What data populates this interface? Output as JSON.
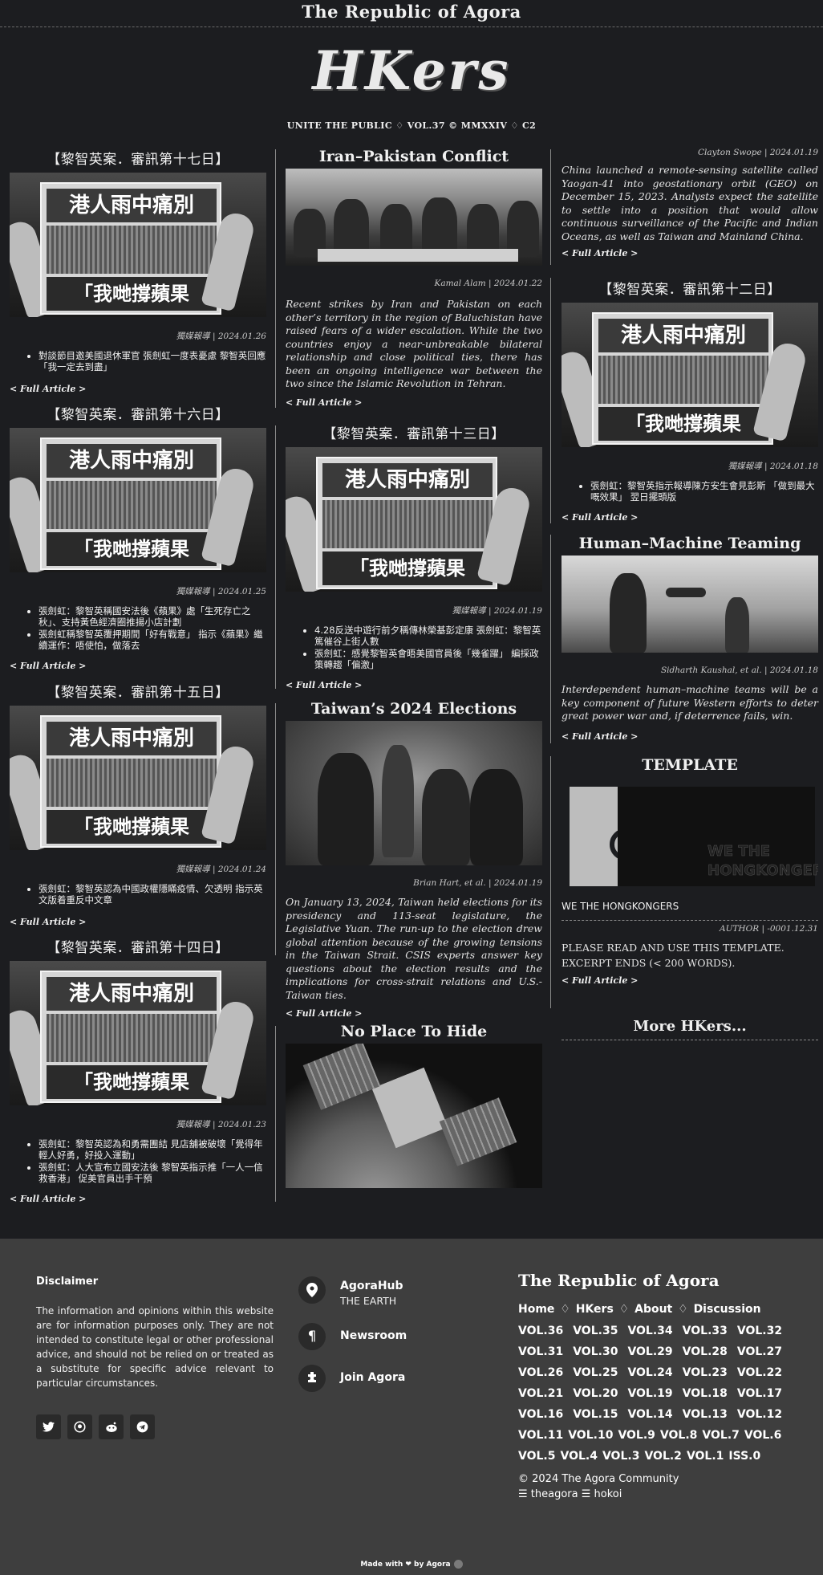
{
  "site": {
    "top_title": "The Republic of Agora",
    "logo": "HKers",
    "tagline": "UNITE THE PUBLIC ♢ VOL.37 © MMXXIV ♢ C2"
  },
  "labels": {
    "full_article": "< Full Article >",
    "more": "More HKers..."
  },
  "col1": [
    {
      "title": "【黎智英案．審訊第十七日】",
      "paper_top": "港人雨中痛別",
      "paper_bottom": "「我哋撐蘋果",
      "meta": "獨媒報導 | 2024.01.26",
      "bullets": [
        "對談節目邀美國退休軍官 張劍虹一度表憂慮 黎智英回應「我一定去到盡」"
      ]
    },
    {
      "title": "【黎智英案．審訊第十六日】",
      "paper_top": "港人雨中痛別",
      "paper_bottom": "「我哋撐蘋果",
      "meta": "獨媒報導 | 2024.01.25",
      "bullets": [
        "張劍虹：黎智英稱國安法後《蘋果》處「生死存亡之秋」、支持黃色經濟圈推揚小店計劃",
        "張劍虹稱黎智英覆押期間「好有戰意」 指示《蘋果》繼續運作：唔使怕，做落去"
      ]
    },
    {
      "title": "【黎智英案．審訊第十五日】",
      "paper_top": "港人雨中痛別",
      "paper_bottom": "「我哋撐蘋果",
      "meta": "獨媒報導 | 2024.01.24",
      "bullets": [
        "張劍虹：黎智英認為中國政權隱瞞疫情、欠透明 指示英文版着重反中文章"
      ]
    },
    {
      "title": "【黎智英案．審訊第十四日】",
      "paper_top": "港人雨中痛別",
      "paper_bottom": "「我哋撐蘋果",
      "meta": "獨媒報導 | 2024.01.23",
      "bullets": [
        "張劍虹：黎智英認為和勇需團結 見店舖被破壞「覺得年輕人好勇，好投入運動」",
        "張劍虹：人大宣布立國安法後 黎智英指示推「一人一信救香港」 促美官員出手干預"
      ]
    }
  ],
  "col2": [
    {
      "title": "Iran–Pakistan Conflict",
      "meta": "Kamal Alam | 2024.01.22",
      "summary": "Recent strikes by Iran and Pakistan on each other’s territory in the region of Baluchistan have raised fears of a wider escalation. While the two countries enjoy a near-unbreakable bilateral relationship and close political ties, there has been an ongoing intelligence war between the two since the Islamic Revolution in Tehran."
    },
    {
      "title": "【黎智英案．審訊第十三日】",
      "paper_top": "港人雨中痛別",
      "paper_bottom": "「我哋撐蘋果",
      "meta": "獨媒報導 | 2024.01.19",
      "bullets": [
        "4.28反送中遊行前夕稱傳林榮基彭定康 張劍虹：黎智英篤催谷上街人數",
        "張劍虹：感覺黎智英會晤美國官員後「幾雀躍」 編採政策轉趨「偏激」"
      ]
    },
    {
      "title": "Taiwan’s 2024 Elections",
      "meta": "Brian Hart, et al. | 2024.01.19",
      "summary": "On January 13, 2024, Taiwan held elections for its presidency and 113-seat legislature, the Legislative Yuan. The run-up to the election drew global attention because of the growing tensions in the Taiwan Strait. CSIS experts answer key questions about the election results and the implications for cross-strait relations and U.S.-Taiwan ties."
    },
    {
      "title": "No Place To Hide"
    }
  ],
  "col3": [
    {
      "meta": "Clayton Swope | 2024.01.19",
      "summary": "China launched a remote-sensing satellite called Yaogan-41 into geostationary orbit (GEO) on December 15, 2023. Analysts expect the satellite to settle into a position that would allow continuous surveillance of the Pacific and Indian Oceans, as well as Taiwan and Mainland China."
    },
    {
      "title": "【黎智英案．審訊第十二日】",
      "paper_top": "港人雨中痛別",
      "paper_bottom": "「我哋撐蘋果",
      "meta": "獨媒報導 | 2024.01.18",
      "bullets": [
        "張劍虹：黎智英指示報導陳方安生會見彭斯 「做到最大嘅效果」 翌日擺頭版"
      ]
    },
    {
      "title": "Human–Machine Teaming",
      "meta": "Sidharth Kaushal, et al. | 2024.01.18",
      "summary": "Interdependent human–machine teams will be a key component of future Western efforts to deter great power war and, if deterrence fails, win."
    },
    {
      "title": "TEMPLATE",
      "logo_text1": "WE THE",
      "logo_text2": "HONGKONGERS",
      "caption": "WE THE HONGKONGERS",
      "meta": "AUTHOR | -0001.12.31",
      "body": "PLEASE READ AND USE THIS TEMPLATE. EXCERPT ENDS (< 200 WORDS)."
    }
  ],
  "footer": {
    "disclaimer_title": "Disclaimer",
    "disclaimer": "The information and opinions within this website are for information purposes only. They are not intended to constitute legal or other professional advice, and should not be relied on or treated as a substitute for specific advice relevant to particular circumstances.",
    "hub_title": "AgoraHub",
    "hub_sub": "THE EARTH",
    "newsroom": "Newsroom",
    "join": "Join Agora",
    "brand": "The Republic of Agora",
    "nav": [
      "Home",
      "HKers",
      "About",
      "Discussion"
    ],
    "nav_sep": "♢",
    "vols": [
      "VOL.36",
      "VOL.35",
      "VOL.34",
      "VOL.33",
      "VOL.32",
      "VOL.31",
      "VOL.30",
      "VOL.29",
      "VOL.28",
      "VOL.27",
      "VOL.26",
      "VOL.25",
      "VOL.24",
      "VOL.23",
      "VOL.22",
      "VOL.21",
      "VOL.20",
      "VOL.19",
      "VOL.18",
      "VOL.17",
      "VOL.16",
      "VOL.15",
      "VOL.14",
      "VOL.13",
      "VOL.12",
      "VOL.11",
      "VOL.10",
      "VOL.9",
      "VOL.8",
      "VOL.7",
      "VOL.6",
      "VOL.5",
      "VOL.4",
      "VOL.3",
      "VOL.2",
      "VOL.1",
      "ISS.0"
    ],
    "copyright": "© 2024 The Agora Community",
    "handles": "☰ theagora ☰ hokoi",
    "made_with": "Made with ❤ by Agora"
  }
}
